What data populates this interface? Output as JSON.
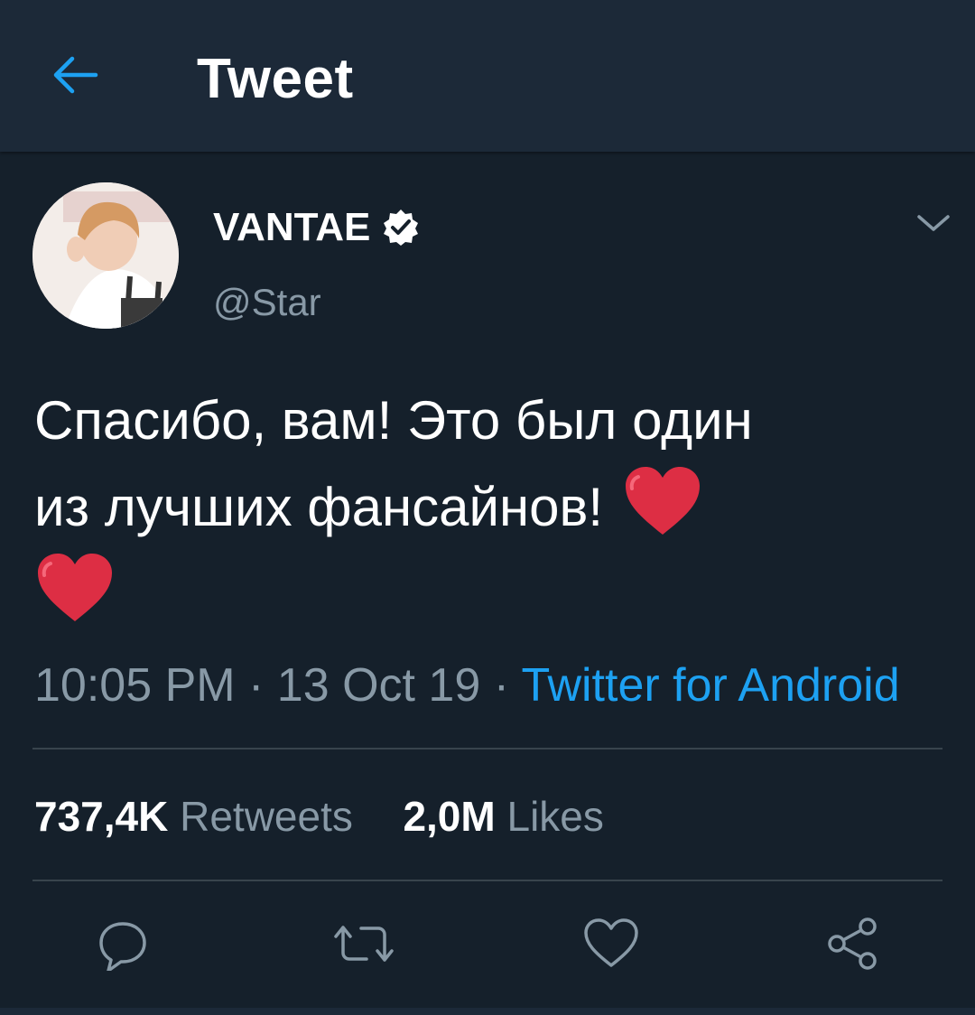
{
  "header": {
    "title": "Tweet",
    "back_icon": "arrow-left-icon"
  },
  "colors": {
    "background": "#15202b",
    "header_bg": "#1c2938",
    "accent": "#1da1f2",
    "secondary_text": "#8899a6",
    "divider": "#38444d",
    "heart": "#e0245e"
  },
  "tweet": {
    "author_name": "VANTAE",
    "handle": "@Star",
    "verified": true,
    "text_line1": "Спасибо, вам! Это был один",
    "text_line2": "из лучших фансайнов! ",
    "emojis": [
      "red-heart",
      "red-heart"
    ],
    "time": "10:05 PM",
    "separator1": " · ",
    "date": "13 Oct 19",
    "separator2": " · ",
    "source": "Twitter for Android"
  },
  "stats": {
    "retweets_count": "737,4K",
    "retweets_label": "Retweets",
    "likes_count": "2,0M",
    "likes_label": "Likes"
  },
  "actions": [
    {
      "name": "reply",
      "icon": "reply-icon"
    },
    {
      "name": "retweet",
      "icon": "retweet-icon"
    },
    {
      "name": "like",
      "icon": "heart-outline-icon"
    },
    {
      "name": "share",
      "icon": "share-icon"
    }
  ]
}
